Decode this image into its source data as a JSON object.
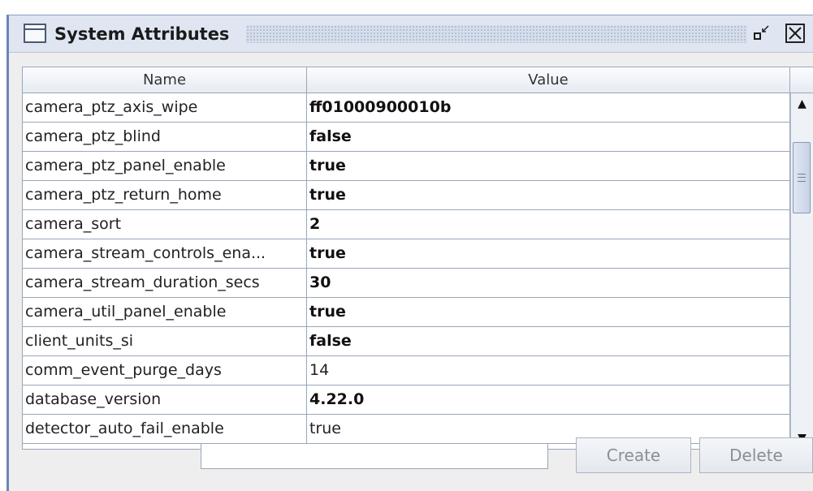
{
  "window": {
    "title": "System Attributes",
    "minimize_glyph": "▫↙",
    "close_glyph": "✕"
  },
  "table": {
    "columns": [
      "Name",
      "Value"
    ],
    "rows": [
      {
        "name": "camera_ptz_axis_wipe",
        "value": "ff01000900010b",
        "bold": true
      },
      {
        "name": "camera_ptz_blind",
        "value": "false",
        "bold": true
      },
      {
        "name": "camera_ptz_panel_enable",
        "value": "true",
        "bold": true
      },
      {
        "name": "camera_ptz_return_home",
        "value": "true",
        "bold": true
      },
      {
        "name": "camera_sort",
        "value": "2",
        "bold": true
      },
      {
        "name": "camera_stream_controls_ena...",
        "value": "true",
        "bold": true
      },
      {
        "name": "camera_stream_duration_secs",
        "value": "30",
        "bold": true
      },
      {
        "name": "camera_util_panel_enable",
        "value": "true",
        "bold": true
      },
      {
        "name": "client_units_si",
        "value": "false",
        "bold": true
      },
      {
        "name": "comm_event_purge_days",
        "value": "14",
        "bold": false
      },
      {
        "name": "database_version",
        "value": "4.22.0",
        "bold": true
      },
      {
        "name": "detector_auto_fail_enable",
        "value": "true",
        "bold": false
      }
    ]
  },
  "scrollbar": {
    "up_glyph": "▲",
    "down_glyph": "▼"
  },
  "footer": {
    "input_value": "",
    "create_label": "Create",
    "delete_label": "Delete"
  },
  "icons": {
    "window": "window-icon",
    "minimize": "minimize-icon",
    "close": "close-icon"
  }
}
